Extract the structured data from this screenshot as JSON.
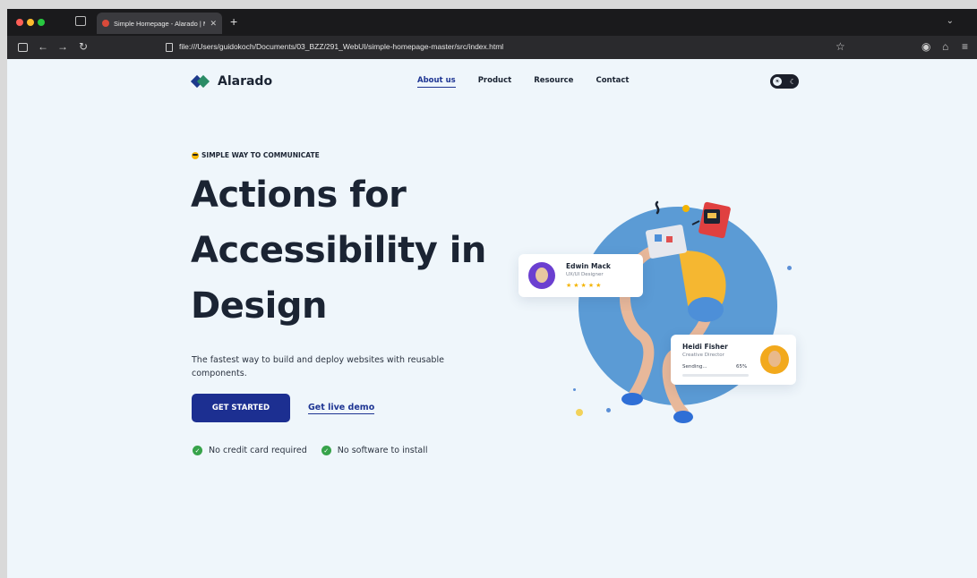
{
  "browser": {
    "tab_title": "Simple Homepage - Alarado | M",
    "url": "file:///Users/guidokoch/Documents/03_BZZ/291_WebUI/simple-homepage-master/src/index.html",
    "icons": [
      "back-icon",
      "forward-icon",
      "reload-icon",
      "bookmark-star-icon",
      "profile-icon",
      "extensions-icon",
      "menu-icon"
    ]
  },
  "site": {
    "brand": "Alarado",
    "nav": [
      {
        "label": "About us",
        "active": true
      },
      {
        "label": "Product",
        "active": false
      },
      {
        "label": "Resource",
        "active": false
      },
      {
        "label": "Contact",
        "active": false
      }
    ]
  },
  "hero": {
    "eyebrow": "SIMPLE WAY TO COMMUNICATE",
    "title_lines": [
      "Actions for",
      "Accessibility in",
      "Design"
    ],
    "subtitle": "The fastest way to build and deploy websites with reusable components.",
    "cta_label": "GET STARTED",
    "demo_label": "Get live demo",
    "perks": [
      "No credit card required",
      "No software to install"
    ]
  },
  "illustration": {
    "card_one": {
      "name": "Edwin Mack",
      "role": "UX/UI Designer",
      "stars": "★★★★★",
      "rating": 5
    },
    "card_two": {
      "name": "Heidi Fisher",
      "role": "Creative Director",
      "status": "Sending...",
      "progress_label": "65%",
      "progress": 0.65
    }
  },
  "colors": {
    "page_bg": "#eff6fb",
    "primary": "#1c2f91",
    "heading": "#1b2433",
    "check": "#37a34a",
    "circle": "#5b9bd5"
  }
}
